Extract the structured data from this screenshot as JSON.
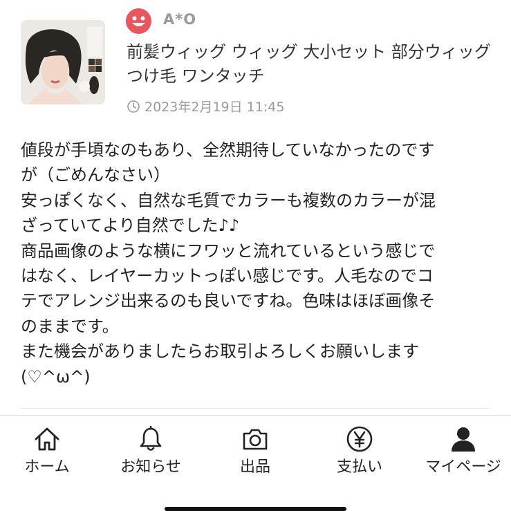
{
  "review": {
    "user_name": "A*O",
    "product_title": "前髪ウィッグ ウィッグ 大小セット 部分ウィッグ つけ毛 ワンタッチ",
    "date": "2023年2月19日 11:45",
    "body_lines": [
      "値段が手頃なのもあり、全然期待していなかったのです",
      "が（ごめんなさい）",
      "安っぽくなく、自然な毛質でカラーも複数のカラーが混",
      "ざっていてより自然でした♪♪",
      "商品画像のような横にフワッと流れているという感じで",
      "はなく、レイヤーカットっぽい感じです。人毛なのでコ",
      "テでアレンジ出来るのも良いですね。色味はほぼ画像そ",
      "のままです。",
      "また機会がありましたらお取引よろしくお願いします",
      "(♡^ω^)"
    ],
    "avatar_color": "#e8565e"
  },
  "tabbar": {
    "items": [
      {
        "label": "ホーム",
        "icon": "home-icon"
      },
      {
        "label": "お知らせ",
        "icon": "bell-icon"
      },
      {
        "label": "出品",
        "icon": "camera-icon"
      },
      {
        "label": "支払い",
        "icon": "yen-icon"
      },
      {
        "label": "マイページ",
        "icon": "person-icon"
      }
    ]
  }
}
